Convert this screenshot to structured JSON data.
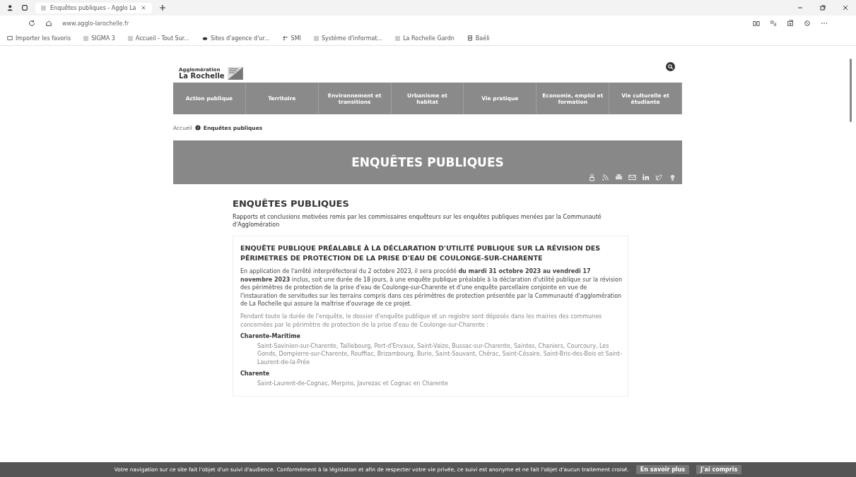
{
  "browser": {
    "tab_title": "Enquêtes publiques - Agglo La",
    "url": "www.agglo-larochelle.fr",
    "bookmarks": [
      {
        "label": "Importer les favoris",
        "kind": "import"
      },
      {
        "label": "SIGMA 3",
        "kind": "page"
      },
      {
        "label": "Accueil - Tout Sur...",
        "kind": "page"
      },
      {
        "label": "Sites d'agence d'ur...",
        "kind": "cloud"
      },
      {
        "label": "SMI",
        "kind": "grid"
      },
      {
        "label": "Système d'informat...",
        "kind": "page"
      },
      {
        "label": "La Rochelle Gardn",
        "kind": "page"
      },
      {
        "label": "Baéli",
        "kind": "doc"
      }
    ]
  },
  "site": {
    "logo": {
      "small": "Agglomération",
      "name": "La Rochelle"
    },
    "nav": [
      {
        "label": "Action publique"
      },
      {
        "label": "Territoire"
      },
      {
        "label": "Environnement et transitions"
      },
      {
        "label": "Urbanisme et habitat"
      },
      {
        "label": "Vie pratique"
      },
      {
        "label": "Economie, emploi et formation"
      },
      {
        "label": "Vie culturelle et étudiante"
      }
    ],
    "breadcrumb": [
      "Accueil",
      "Enquêtes publiques"
    ],
    "banner_title": "ENQUÊTES PUBLIQUES",
    "page_title": "ENQUÊTES PUBLIQUES",
    "intro": "Rapports et conclusions motivées remis par les commissaires enquêteurs sur les enquêtes publiques menées par la Communauté d'Agglomération",
    "article": {
      "title": "ENQUÊTE PUBLIQUE PRÉALABLE À LA DÉCLARATION D'UTILITÉ PUBLIQUE SUR LA RÉVISION DES PÉRIMETRES DE PROTECTION DE LA PRISE D'EAU DE COULONGE-SUR-CHARENTE",
      "paragraphs": [
        {
          "text": "En application de l'arrêté interpréfectoral du 2 octobre 2023, il sera procédé **du mardi 31 octobre 2023 au vendredi 17 novembre 2023** inclus, soit une durée de 18 jours, à une enquête publique préalable à la déclaration d'utilité publique sur la révision des périmètres de protection de la prise d'eau de Coulonge-sur-Charente et d'une enquête parcellaire conjointe en vue de l'instauration de servitudes sur les terrains compris dans ces périmètres de protection présentée par la Communauté d'agglomération de La Rochelle qui assure la maîtrise d'ouvrage de ce projet.",
          "faded": false
        },
        {
          "text": "Pendant toute la durée de l'enquête, le dossier d'enquête publique et un registre sont déposés dans les mairies des communes concernées par le périmètre de protection de la prise d'eau de Coulonge-sur-Charente :",
          "faded": true
        }
      ],
      "sections": [
        {
          "heading": "Charente-Maritime",
          "items": [
            "Saint-Savinien-sur-Charente, Taillebourg, Port-d'Envaux, Saint-Vaize, Bussac-sur-Charente, Saintes, Chaniers, Courcoury, Les Gonds, Dompierre-sur-Charente, Rouffiac, Brizambourg, Burie, Saint-Sauvant, Chérac, Saint-Césaire, Saint-Bris-des-Bois et Saint-Laurent-de-la-Prée"
          ]
        },
        {
          "heading": "Charente",
          "items": [
            "Saint-Laurent-de-Cognac, Merpins, Javrezac et Cognac en Charente"
          ]
        }
      ]
    }
  },
  "cookie": {
    "text": "Votre navigation sur ce site fait l'objet d'un suivi d'audience. Conformément à la législation et afin de respecter votre vie privée, ce suivi est anonyme et ne fait l'objet d'aucun traitement croisé.",
    "buttons": [
      "En savoir plus",
      "J'ai compris"
    ]
  }
}
